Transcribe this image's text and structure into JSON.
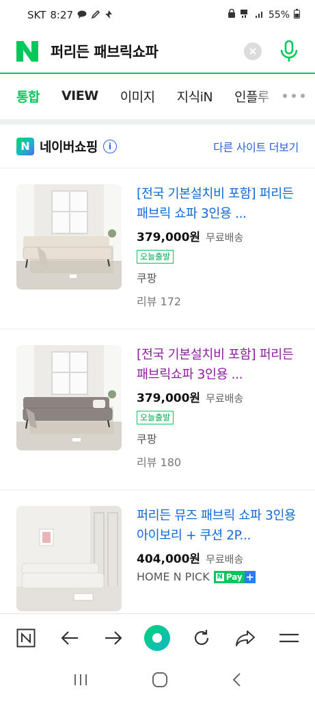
{
  "status_bar": {
    "carrier": "SKT",
    "time": "8:27",
    "battery": "55%"
  },
  "search": {
    "query": "퍼리든 패브릭쇼파"
  },
  "tabs": [
    {
      "label": "통합"
    },
    {
      "label": "VIEW"
    },
    {
      "label": "이미지"
    },
    {
      "label": "지식iN"
    },
    {
      "label": "인플루"
    }
  ],
  "section": {
    "logo_letter": "N",
    "title": "네이버쇼핑",
    "info_symbol": "i",
    "more_link": "다른 사이트 더보기"
  },
  "products": [
    {
      "title": "[전국 기본설치비 포함] 퍼리든 패브릭 쇼파 3인용 ...",
      "price": "379,000원",
      "shipping": "무료배송",
      "badge": "오늘출발",
      "mall": "쿠팡",
      "review": "리뷰 172",
      "sofa_color": "#e8e0d4"
    },
    {
      "title": "[전국 기본설치비 포함] 퍼리든 패브릭쇼파 3인용 ...",
      "price": "379,000원",
      "shipping": "무료배송",
      "badge": "오늘출발",
      "mall": "쿠팡",
      "review": "리뷰 180",
      "sofa_color": "#8c8480"
    },
    {
      "title": "퍼리든 뮤즈 패브릭 쇼파 3인용 아이보리 + 쿠션 2P...",
      "price": "404,000원",
      "shipping": "무료배송",
      "mall": "HOME N PICK",
      "npay_label": "Pay",
      "npay_letter": "N",
      "npay_plus": "+",
      "sofa_color": "#f2f1ee"
    }
  ],
  "colors": {
    "brand_green": "#03c75a",
    "link_blue": "#0f6bd3",
    "visited_purple": "#8e1e9e"
  }
}
